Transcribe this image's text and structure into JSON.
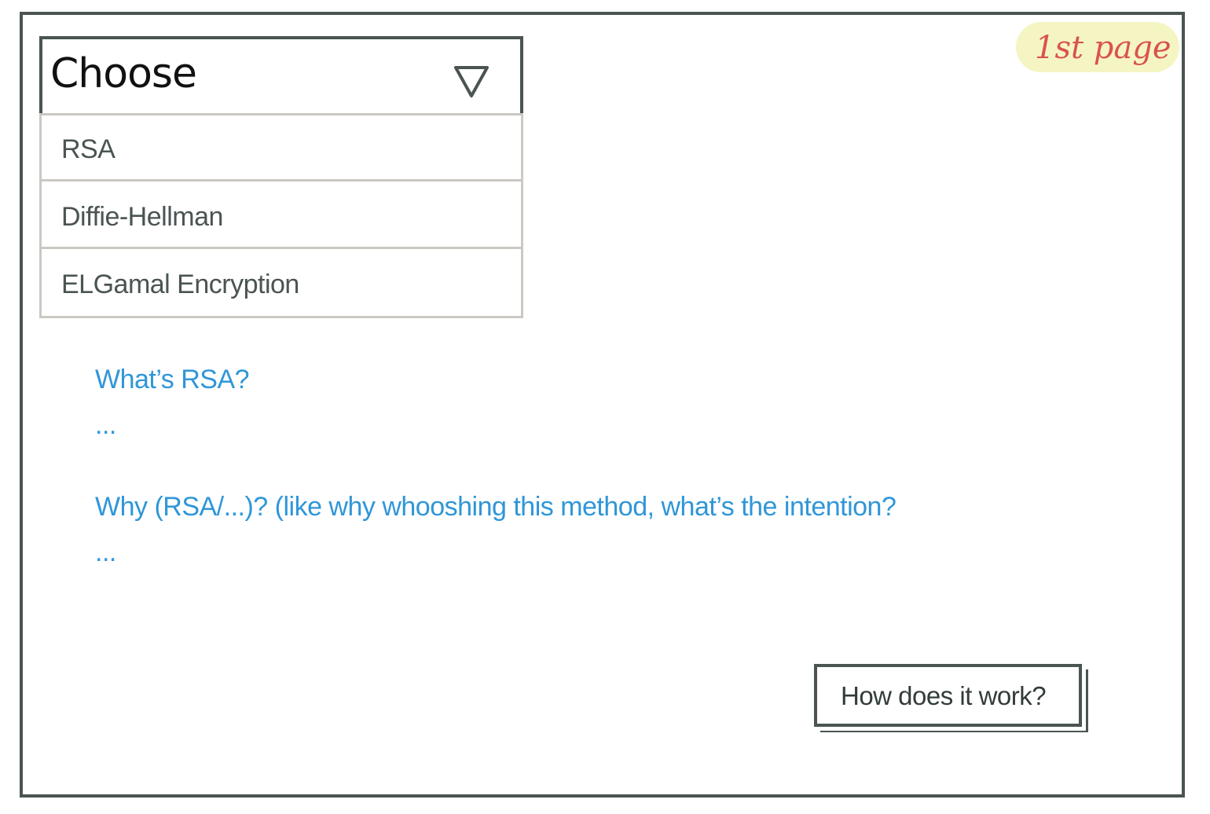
{
  "page": {
    "badge_label": "1st page"
  },
  "dropdown": {
    "selected_label": "Choose",
    "options": [
      {
        "label": "RSA"
      },
      {
        "label": "Diffie-Hellman"
      },
      {
        "label": "ELGamal Encryption"
      }
    ]
  },
  "content": {
    "question_1": "What’s RSA?",
    "answer_1": "...",
    "question_2": "Why (RSA/...)? (like why whooshing this method, what’s the intention?",
    "answer_2": "..."
  },
  "actions": {
    "how_it_works_label": "How does it work?"
  },
  "colors": {
    "border": "#4a5453",
    "menu_border": "#cbc8c2",
    "link_blue": "#2f96d8",
    "badge_bg": "#f5f5c4",
    "badge_text": "#d9534f"
  },
  "icons": {
    "dropdown_arrow": "triangle-down-icon"
  }
}
